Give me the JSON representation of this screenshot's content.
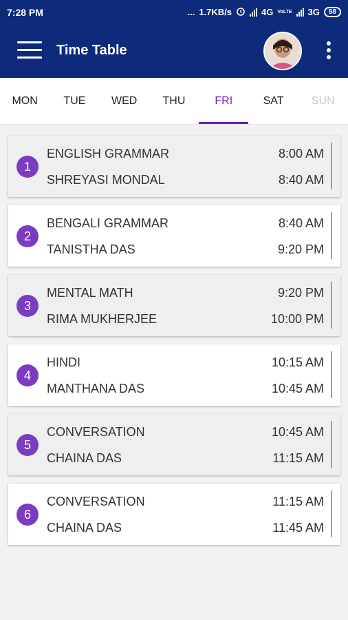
{
  "status_bar": {
    "time": "7:28 PM",
    "dots": "...",
    "speed": "1.7KB/s",
    "alarm_icon": "alarm-icon",
    "network1": "4G",
    "volte": "VoLTE",
    "network2": "3G",
    "battery": "58"
  },
  "app_bar": {
    "title": "Time Table",
    "menu_icon": "hamburger-menu-icon",
    "more_icon": "more-vert-icon"
  },
  "tabs": [
    {
      "label": "MON"
    },
    {
      "label": "TUE"
    },
    {
      "label": "WED"
    },
    {
      "label": "THU"
    },
    {
      "label": "FRI"
    },
    {
      "label": "SAT"
    },
    {
      "label": "SUN"
    }
  ],
  "periods": [
    {
      "num": "1",
      "subject": "ENGLISH GRAMMAR",
      "teacher": "SHREYASI MONDAL",
      "start": "8:00 AM",
      "end": "8:40 AM"
    },
    {
      "num": "2",
      "subject": "BENGALI GRAMMAR",
      "teacher": "TANISTHA DAS",
      "start": "8:40 AM",
      "end": "9:20 PM"
    },
    {
      "num": "3",
      "subject": "MENTAL MATH",
      "teacher": "RIMA MUKHERJEE",
      "start": "9:20 PM",
      "end": "10:00 PM"
    },
    {
      "num": "4",
      "subject": "HINDI",
      "teacher": "MANTHANA DAS",
      "start": "10:15 AM",
      "end": "10:45 AM"
    },
    {
      "num": "5",
      "subject": "CONVERSATION",
      "teacher": "CHAINA DAS",
      "start": "10:45 AM",
      "end": "11:15 AM"
    },
    {
      "num": "6",
      "subject": "CONVERSATION",
      "teacher": "CHAINA DAS",
      "start": "11:15 AM",
      "end": "11:45 AM"
    }
  ],
  "colors": {
    "app_bar": "#0e2a7a",
    "accent": "#6a22b8",
    "period_badge": "#7b3cc2",
    "time_divider": "#6cc46a"
  }
}
